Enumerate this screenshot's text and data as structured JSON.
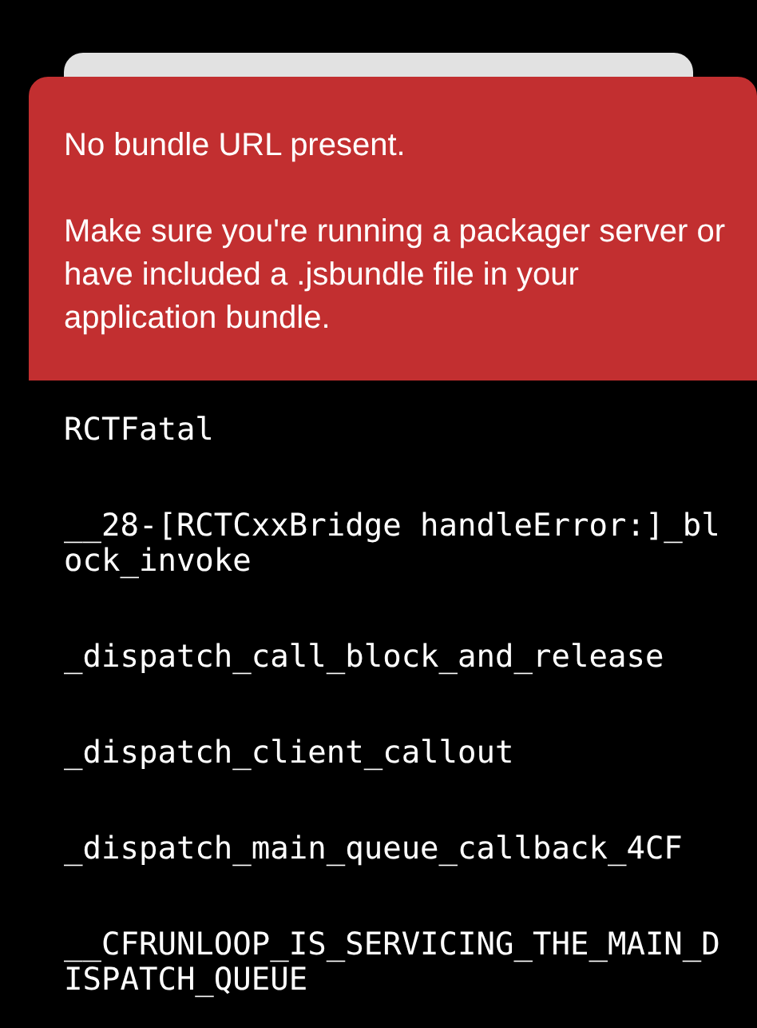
{
  "error_banner": {
    "title": "No bundle URL present.",
    "message": "Make sure you're running a packager server or have included a .jsbundle file in your application bundle."
  },
  "stack_trace": [
    "RCTFatal",
    "__28-[RCTCxxBridge handleError:]_block_invoke",
    "_dispatch_call_block_and_release",
    "_dispatch_client_callout",
    "_dispatch_main_queue_callback_4CF",
    "__CFRUNLOOP_IS_SERVICING_THE_MAIN_DISPATCH_QUEUE"
  ]
}
